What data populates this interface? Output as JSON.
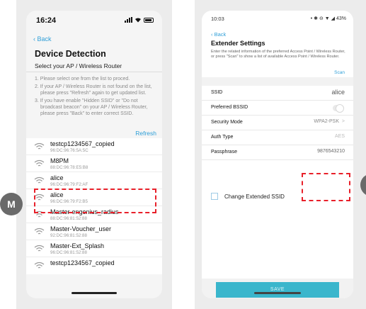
{
  "left_phone": {
    "status_time": "16:24",
    "back_label": "Back",
    "title": "Device Detection",
    "subtitle": "Select your AP / Wireless Router",
    "instructions": [
      "1. Please select one from the list to proced.",
      "2. If your AP / Wireless Router is not found on the list, please press \"Refresh\" again to get updated list.",
      "3. If you have enable \"Hidden SSID\" or \"Do not broadcast beacon\" on your AP / Wireless Router, please press \"Back\" to enter correct SSID."
    ],
    "refresh_label": "Refresh",
    "networks": [
      {
        "name": "testcp1234567_copied",
        "mac": "96:DC:96:76:5A:5C"
      },
      {
        "name": "M8PM",
        "mac": "88:DC:96:78:E5:B8"
      },
      {
        "name": "alice",
        "mac": "96:DC:96:79:F2:AF"
      },
      {
        "name": "alice",
        "mac": "96:DC:96:79:F2:B5"
      },
      {
        "name": "Master-engenius_radius",
        "mac": "88:DC:96:81:52:88"
      },
      {
        "name": "Master-Voucher_user",
        "mac": "92:DC:96:81:52:88"
      },
      {
        "name": "Master-Ext_Splash",
        "mac": "96:DC:96:81:52:88"
      },
      {
        "name": "testcp1234567_copied",
        "mac": ""
      }
    ]
  },
  "right_phone": {
    "status_time": "10:03",
    "status_icons": "• ✱ ⊖ ▼ ◢ 43%",
    "back_label": "Back",
    "title": "Extender Settings",
    "description": "Enter the related information of the preferred Access Point / Wireless Router, or press \"Scan\" to show a list of available Access Point / Wireless Router.",
    "scan_label": "Scan",
    "fields": {
      "ssid": {
        "label": "SSID",
        "value": "alice"
      },
      "preferred_bssid": {
        "label": "Preferred BSSID",
        "enabled": false
      },
      "security_mode": {
        "label": "Security Mode",
        "value": "WPA2-PSK",
        "chevron": ">"
      },
      "auth_type": {
        "label": "Auth Type",
        "value": "AES"
      },
      "passphrase": {
        "label": "Passphrase",
        "value": "9876543210"
      }
    },
    "change_extended_ssid_label": "Change Extended SSID",
    "save_label": "SAVE"
  },
  "marker_label": "M",
  "colors": {
    "accent": "#2f9fd8",
    "save_button": "#3ab6cc",
    "highlight": "#e8202a",
    "marker": "#6a6a6a"
  }
}
